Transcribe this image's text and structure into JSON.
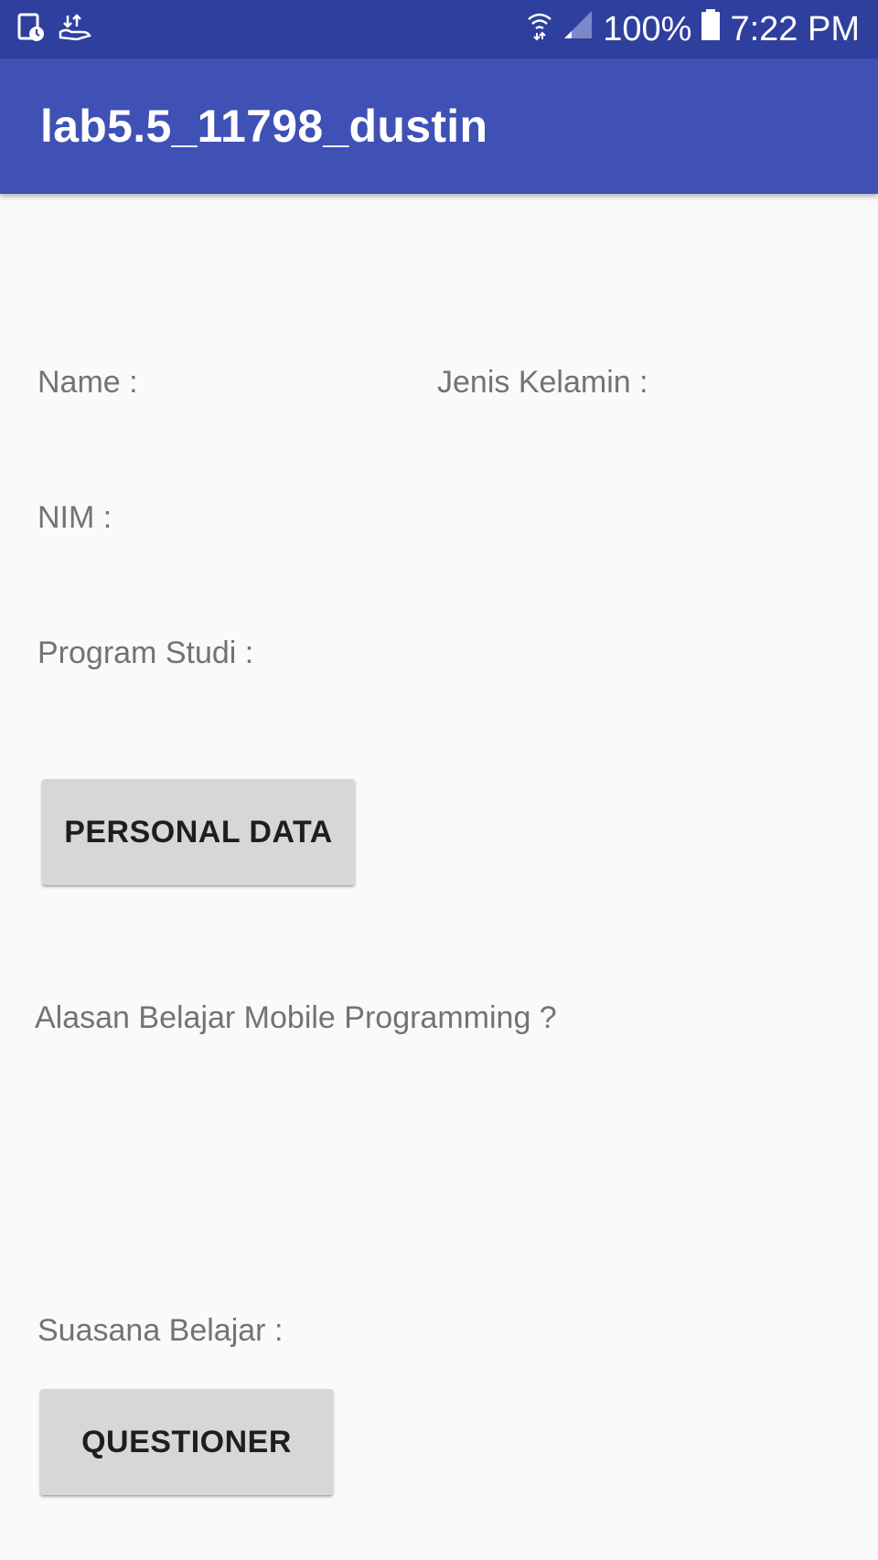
{
  "status_bar": {
    "left_icons": [
      "screen-timer-icon",
      "data-transfer-icon"
    ],
    "right_icons": [
      "wifi-icon",
      "signal-icon",
      "battery-icon"
    ],
    "battery": "100%",
    "time": "7:22 PM"
  },
  "app_bar": {
    "title": "lab5.5_11798_dustin",
    "color": "#3f51b5",
    "status_color": "#2e3f9e"
  },
  "form": {
    "name_label": "Name :",
    "gender_label": "Jenis Kelamin :",
    "nim_label": "NIM :",
    "program_label": "Program Studi :",
    "personal_data_button": "PERSONAL DATA",
    "reason_label": "Alasan Belajar Mobile Programming ?",
    "atmosphere_label": "Suasana Belajar :",
    "questioner_button": "QUESTIONER"
  },
  "colors": {
    "background": "#fafafa",
    "label_text": "#737373",
    "button_bg": "#d6d7d7"
  }
}
